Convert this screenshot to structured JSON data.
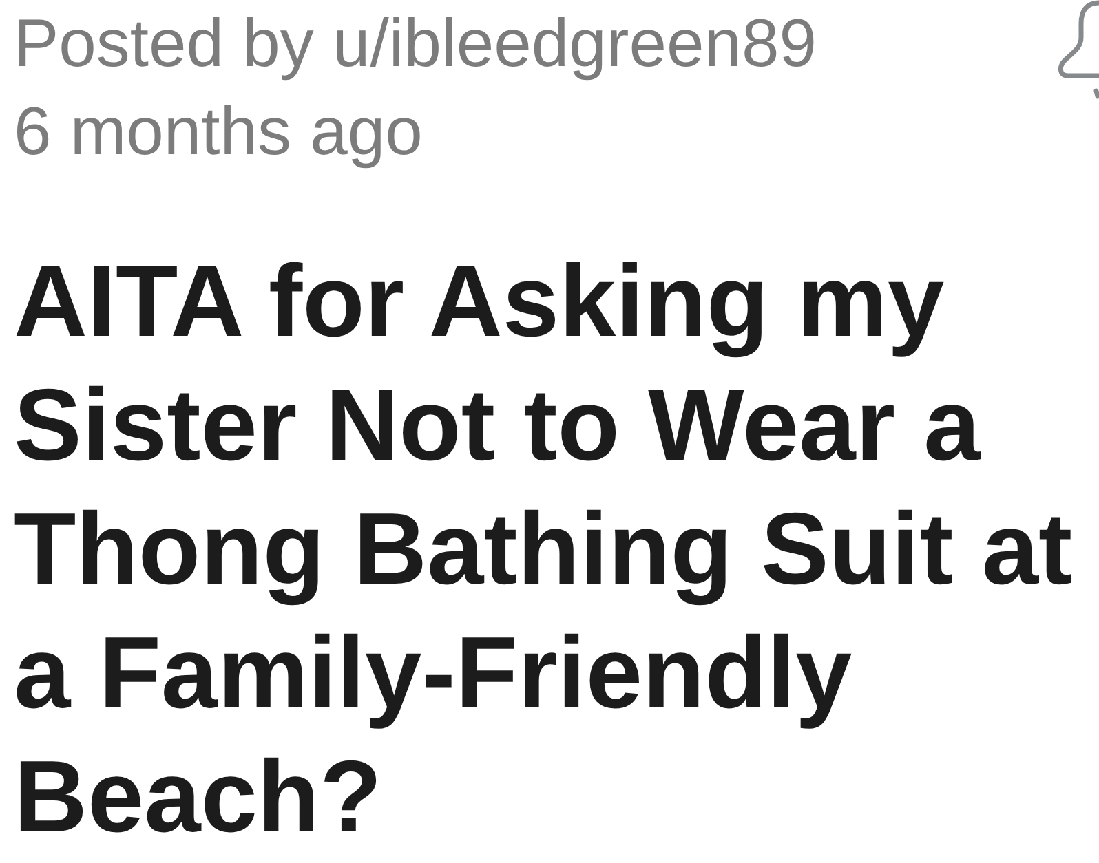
{
  "post": {
    "author_line": "Posted by u/ibleedgreen89",
    "time": "6 months ago",
    "title": "AITA for Asking my Sister Not to Wear a Thong Bathing Suit at a Family-Friendly Beach?"
  }
}
